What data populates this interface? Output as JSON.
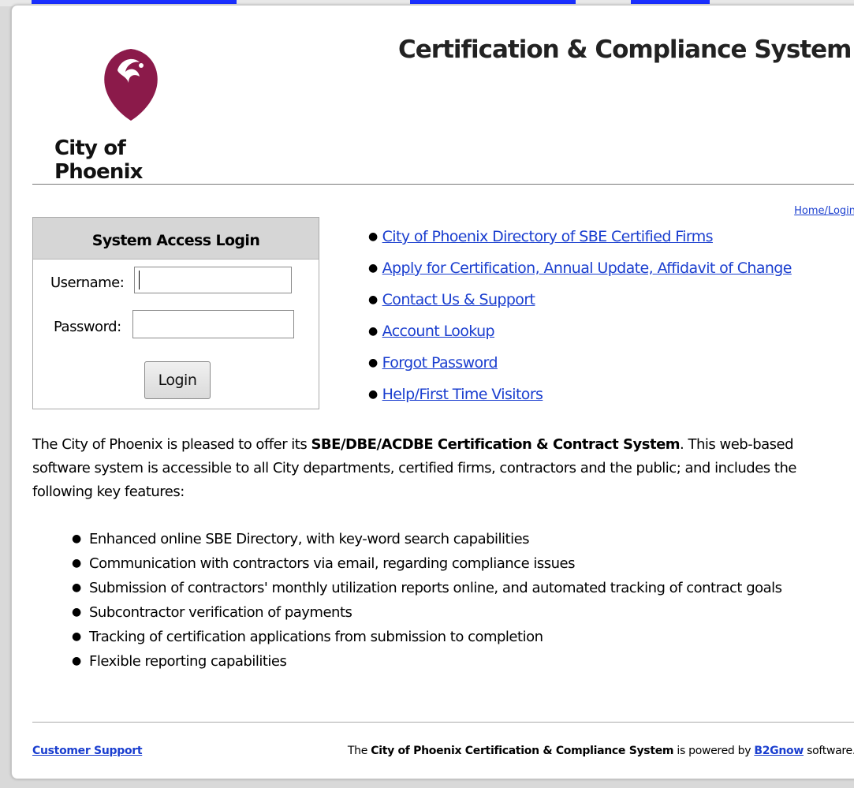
{
  "header": {
    "logo_text": "City of Phoenix",
    "system_title": "Certification & Compliance System",
    "home_link": "Home/Login"
  },
  "login": {
    "heading": "System Access Login",
    "username_label": "Username:",
    "username_value": "",
    "password_label": "Password:",
    "password_value": "",
    "button_label": "Login"
  },
  "links": [
    "City of Phoenix Directory of SBE Certified Firms",
    "Apply for Certification, Annual Update, Affidavit of Change",
    "Contact Us & Support",
    "Account Lookup",
    "Forgot Password",
    "Help/First Time Visitors"
  ],
  "intro": {
    "prefix": "The City of Phoenix is pleased to offer its ",
    "bold": "SBE/DBE/ACDBE Certification & Contract System",
    "suffix": ". This web-based software system is accessible to all City departments, certified firms, contractors and the public; and includes the following key features:"
  },
  "features": [
    "Enhanced online SBE Directory, with key-word search capabilities",
    "Communication with contractors via email, regarding compliance issues",
    "Submission of contractors' monthly utilization reports online, and automated tracking of contract goals",
    "Subcontractor verification of payments",
    "Tracking of certification applications from submission to completion",
    "Flexible reporting capabilities"
  ],
  "footer": {
    "support_link": "Customer Support",
    "powered_prefix": "The ",
    "powered_bold": "City of Phoenix Certification & Compliance System",
    "powered_middle": " is powered by ",
    "powered_link": "B2Gnow",
    "powered_suffix": " software."
  },
  "colors": {
    "link": "#1a3ecf",
    "logo": "#8b1a4a",
    "box_header": "#d6d6d6"
  }
}
